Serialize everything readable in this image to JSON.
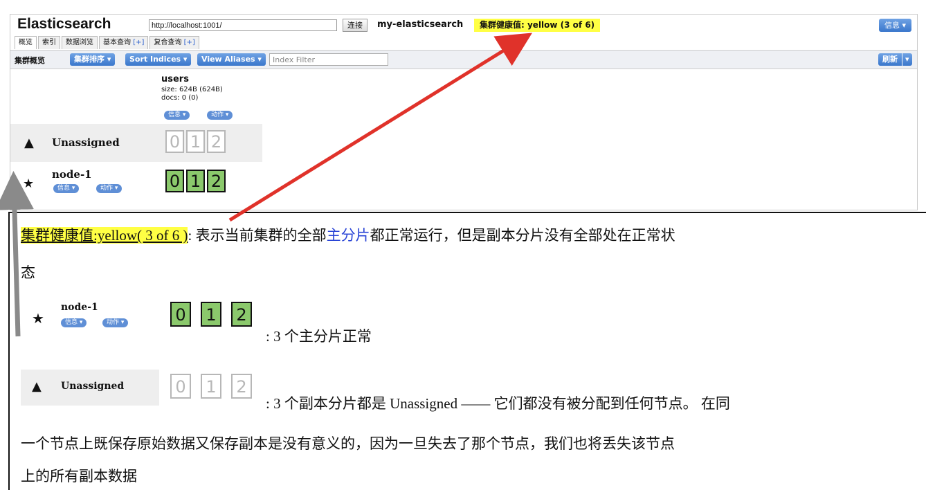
{
  "app": {
    "title": "Elasticsearch",
    "url": "http://localhost:1001/",
    "connect_label": "连接",
    "cluster_name": "my-elasticsearch",
    "health_label": "集群健康值: yellow (3 of 6)",
    "info_label": "信息 ▾"
  },
  "tabs": [
    {
      "label": "概览"
    },
    {
      "label": "索引"
    },
    {
      "label": "数据浏览"
    },
    {
      "label": "基本查询",
      "plus": "[+]"
    },
    {
      "label": "复合查询",
      "plus": "[+]"
    }
  ],
  "toolbar": {
    "overview_label": "集群概览",
    "sort_cluster": "集群排序 ▾",
    "sort_indices": "Sort Indices ▾",
    "view_aliases": "View Aliases ▾",
    "filter_placeholder": "Index Filter",
    "refresh": "刷新",
    "refresh_caret": "▾"
  },
  "index": {
    "name": "users",
    "size": "size: 624B (624B)",
    "docs": "docs: 0 (0)",
    "info_pill": "信息 ▾",
    "action_pill": "动作 ▾"
  },
  "rows": {
    "unassigned": {
      "label": "Unassigned",
      "shards": [
        "0",
        "1",
        "2"
      ]
    },
    "node": {
      "label": "node-1",
      "info_pill": "信息 ▾",
      "action_pill": "动作 ▾",
      "shards": [
        "0",
        "1",
        "2"
      ]
    }
  },
  "doc": {
    "health_hl": "集群健康值:yellow( 3 of 6 )",
    "line1_a": ":  表示当前集群的全部",
    "line1_blue": "主分片",
    "line1_b": "都正常运行，但是副本分片没有全部处在正常状",
    "line2": "态",
    "node_desc": ": 3 个主分片正常",
    "unassigned_desc": ": 3 个副本分片都是 Unassigned —— 它们都没有被分配到任何节点。 在同",
    "line_b": "一个节点上既保存原始数据又保存副本是没有意义的，因为一旦失去了那个节点，我们也将丢失该节点",
    "line_c": "上的所有副本数据"
  },
  "colors": {
    "highlight": "#ffff44",
    "shard_ok": "#8bc96c",
    "arrow_red": "#e0322a",
    "arrow_gray": "#8a8a8a",
    "button_blue": "#3a77cc"
  },
  "icons": {
    "warning": "warning-icon",
    "star": "star-icon"
  }
}
